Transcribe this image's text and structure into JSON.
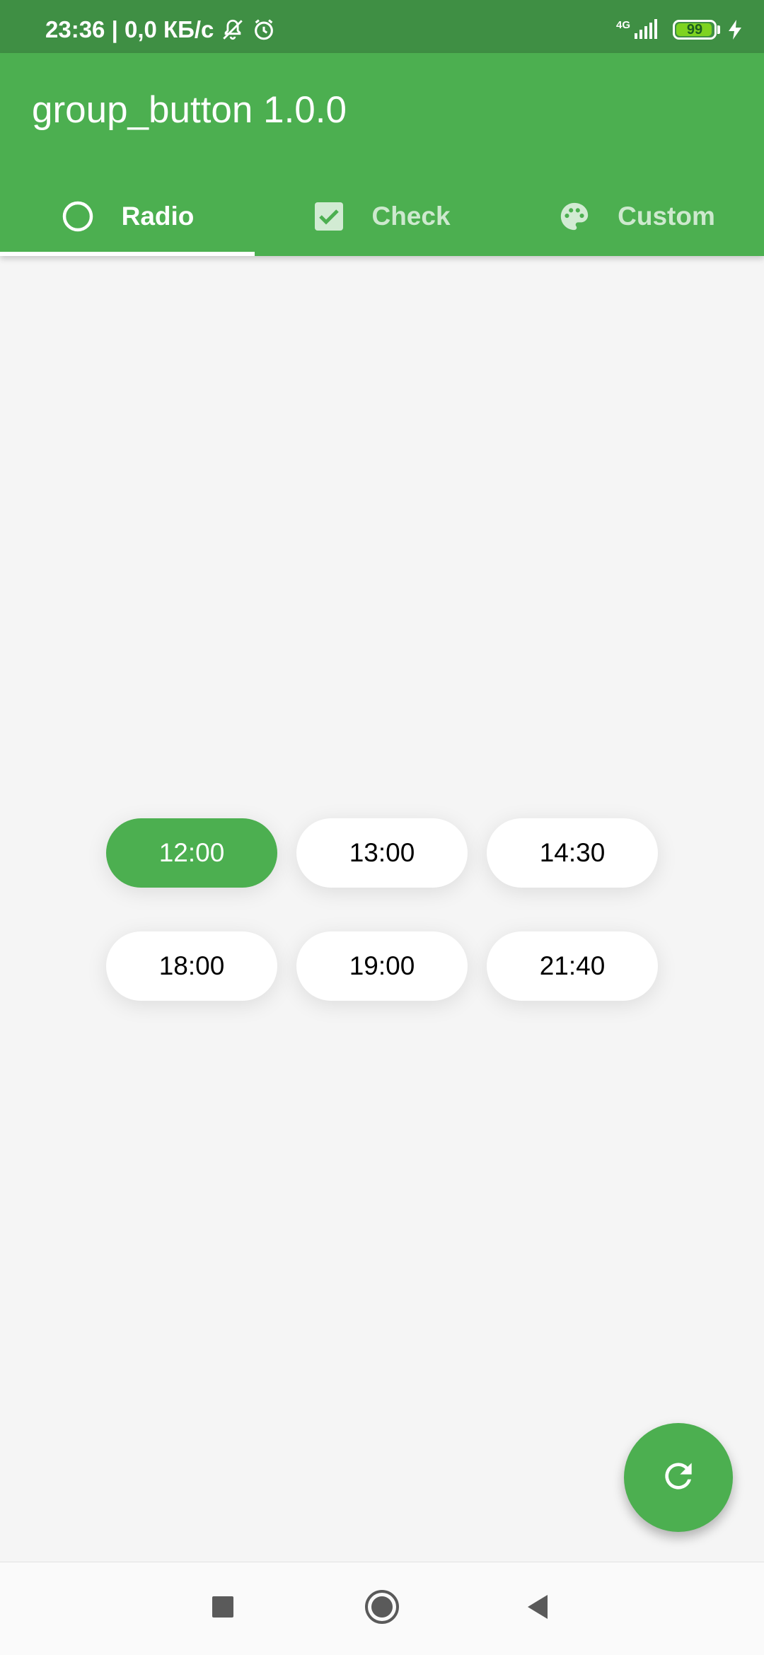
{
  "status_bar": {
    "time_and_speed": "23:36 | 0,0 КБ/с",
    "network_type": "4G",
    "battery_level": "99",
    "icons": [
      "mute-icon",
      "alarm-icon",
      "signal-icon",
      "battery-icon",
      "charging-icon"
    ]
  },
  "app_bar": {
    "title": "group_button 1.0.0",
    "color": "#4caf50"
  },
  "tabs": [
    {
      "label": "Radio",
      "icon": "radio-button-unchecked-icon",
      "active": true
    },
    {
      "label": "Check",
      "icon": "checkbox-checked-icon",
      "active": false
    },
    {
      "label": "Custom",
      "icon": "palette-icon",
      "active": false
    }
  ],
  "group_buttons": [
    {
      "label": "12:00",
      "selected": true
    },
    {
      "label": "13:00",
      "selected": false
    },
    {
      "label": "14:30",
      "selected": false
    },
    {
      "label": "18:00",
      "selected": false
    },
    {
      "label": "19:00",
      "selected": false
    },
    {
      "label": "21:40",
      "selected": false
    }
  ],
  "fab": {
    "icon": "refresh-icon"
  },
  "nav_bar": {
    "buttons": [
      "recents-icon",
      "home-icon",
      "back-icon"
    ]
  },
  "colors": {
    "accent": "#4caf50",
    "status_bar": "#3f8f44",
    "background": "#f5f5f5"
  }
}
